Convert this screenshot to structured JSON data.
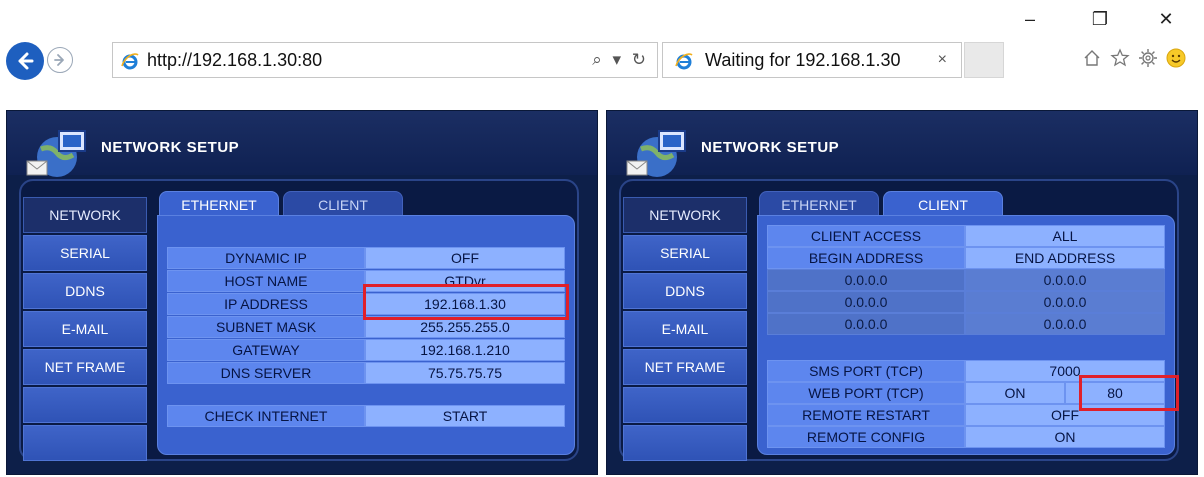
{
  "browser": {
    "window_controls": {
      "minimize": "–",
      "restore": "❐",
      "close": "✕"
    },
    "back_icon": "back-arrow-icon",
    "forward_icon": "forward-arrow-icon",
    "url": "http://192.168.1.30:80",
    "address_tools": "⌕ ▾ ↻",
    "tab_title": "Waiting for 192.168.1.30",
    "tab_close": "×",
    "toolbar_icons": [
      "home-icon",
      "favorites-star-icon",
      "settings-gear-icon",
      "smiley-feedback-icon"
    ]
  },
  "left_panel": {
    "title": "NETWORK SETUP",
    "sidebar": [
      "NETWORK",
      "SERIAL",
      "DDNS",
      "E-MAIL",
      "NET FRAME"
    ],
    "active_sidebar": "NETWORK",
    "tabs": [
      "ETHERNET",
      "CLIENT"
    ],
    "active_tab": "ETHERNET",
    "rows": [
      {
        "label": "DYNAMIC IP",
        "value": "OFF"
      },
      {
        "label": "HOST NAME",
        "value": "GTDvr"
      },
      {
        "label": "IP ADDRESS",
        "value": "192.168.1.30"
      },
      {
        "label": "SUBNET MASK",
        "value": "255.255.255.0"
      },
      {
        "label": "GATEWAY",
        "value": "192.168.1.210"
      },
      {
        "label": "DNS SERVER",
        "value": "75.75.75.75"
      }
    ],
    "check": {
      "label": "CHECK INTERNET",
      "value": "START"
    }
  },
  "right_panel": {
    "title": "NETWORK SETUP",
    "sidebar": [
      "NETWORK",
      "SERIAL",
      "DDNS",
      "E-MAIL",
      "NET FRAME"
    ],
    "active_sidebar": "NETWORK",
    "tabs": [
      "ETHERNET",
      "CLIENT"
    ],
    "active_tab": "CLIENT",
    "client_access": {
      "label": "CLIENT ACCESS",
      "value": "ALL"
    },
    "range_headers": {
      "begin": "BEGIN ADDRESS",
      "end": "END ADDRESS"
    },
    "ranges": [
      {
        "begin": "0.0.0.0",
        "end": "0.0.0.0"
      },
      {
        "begin": "0.0.0.0",
        "end": "0.0.0.0"
      },
      {
        "begin": "0.0.0.0",
        "end": "0.0.0.0"
      }
    ],
    "sms_port": {
      "label": "SMS PORT (TCP)",
      "value": "7000"
    },
    "web_port": {
      "label": "WEB PORT (TCP)",
      "state": "ON",
      "value": "80"
    },
    "remote_restart": {
      "label": "REMOTE RESTART",
      "value": "OFF"
    },
    "remote_config": {
      "label": "REMOTE CONFIG",
      "value": "ON"
    }
  },
  "colors": {
    "highlight": "#e0202a",
    "browser_back": "#1e5fbf",
    "panel_bg": "#0d1f49",
    "content_bg": "#3a62cf"
  }
}
